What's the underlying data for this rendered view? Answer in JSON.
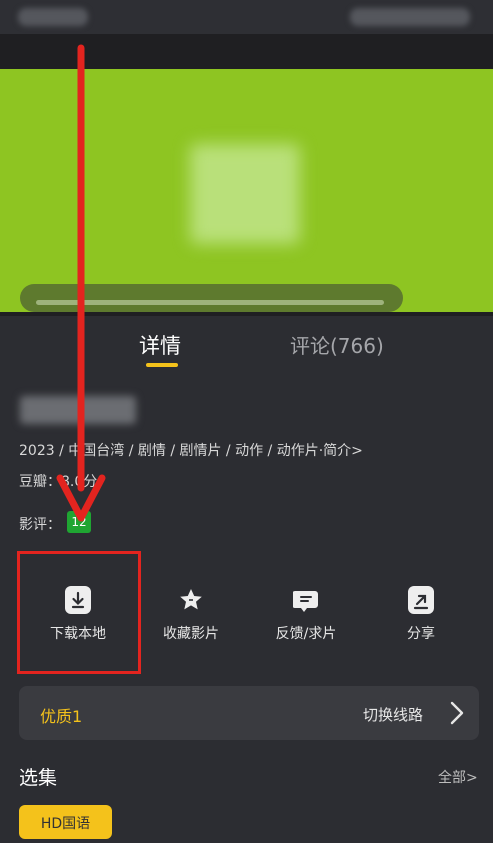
{
  "tabs": {
    "details": "详情",
    "comments": "评论(766)"
  },
  "meta": {
    "info": "2023 / 中国台湾 / 剧情 / 剧情片 / 动作 / 动作片·简介>",
    "douban": "豆瓣：8.0分",
    "review_label": "影评：",
    "review_badge": "12"
  },
  "actions": [
    {
      "label": "下载本地",
      "icon": "download-icon"
    },
    {
      "label": "收藏影片",
      "icon": "star-icon"
    },
    {
      "label": "反馈/求片",
      "icon": "feedback-icon"
    },
    {
      "label": "分享",
      "icon": "share-icon"
    }
  ],
  "source": {
    "name": "优质1",
    "switch": "切换线路"
  },
  "episodes": {
    "heading": "选集",
    "all": "全部>",
    "first": "HD国语"
  },
  "colors": {
    "accent": "#f4c21b",
    "annotation": "#e3241f",
    "video_bg": "#8ec522"
  }
}
